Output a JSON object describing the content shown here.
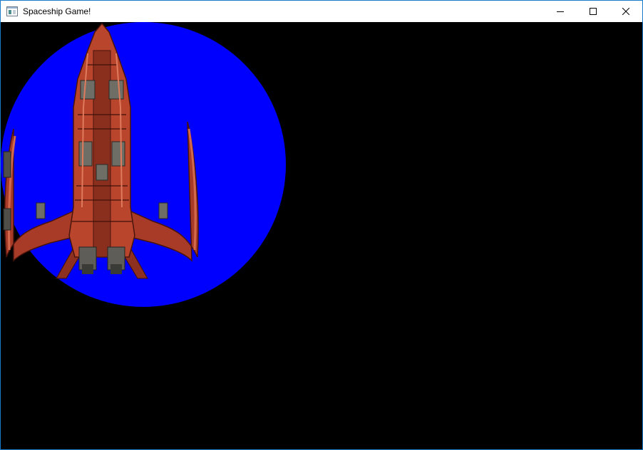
{
  "window": {
    "title": "Spaceship Game!",
    "icon": "app-window-icon",
    "controls": [
      "minimize-icon",
      "maximize-icon",
      "close-icon"
    ]
  },
  "scene": {
    "background_color": "#000000",
    "circle_color": "#0000ff",
    "ship_color": "#b8452c",
    "ship_dark": "#5a1c10",
    "ship_panel": "#6f6e66"
  }
}
